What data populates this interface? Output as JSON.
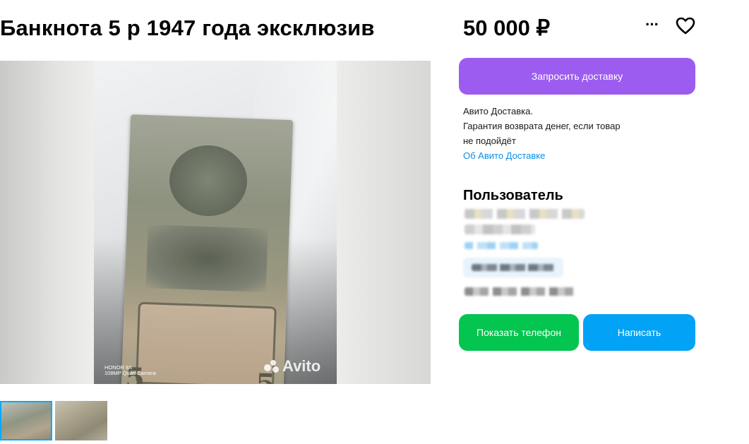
{
  "listing": {
    "title": "Банкнота 5 р 1947 года эксклюзив",
    "price": "50 000 ₽"
  },
  "actions": {
    "more_icon": "more-dots-icon",
    "favorite_icon": "heart-icon"
  },
  "gallery": {
    "camera_watermark_line1": "HONOR 9A",
    "camera_watermark_line2": "108MP Quad Camera",
    "site_watermark": "Avito",
    "thumbnail_count": 2,
    "active_thumbnail": 1
  },
  "delivery": {
    "button_label": "Запросить доставку",
    "info_line1": "Авито Доставка.",
    "info_line2": "Гарантия возврата денег, если товар",
    "info_line3": "не подойдёт",
    "link_label": "Об Авито Доставке"
  },
  "seller": {
    "heading": "Пользователь"
  },
  "contact": {
    "show_phone_label": "Показать телефон",
    "write_label": "Написать"
  },
  "colors": {
    "delivery_button": "#9c5cf0",
    "phone_button": "#03c54f",
    "write_button": "#02a3f6",
    "link": "#0a8fe6"
  }
}
